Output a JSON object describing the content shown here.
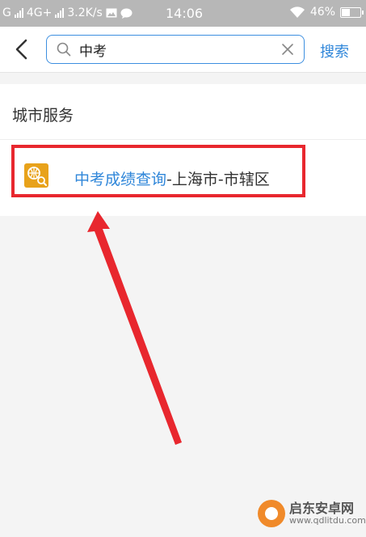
{
  "status_bar": {
    "sim1": "G",
    "sim2": "4G+",
    "speed": "3.2K/s",
    "time": "14:06",
    "battery": "46%",
    "battery_level": 0.46
  },
  "header": {
    "search_value": "中考",
    "search_button": "搜索"
  },
  "section": {
    "title": "城市服务",
    "result": {
      "highlight": "中考成绩查询",
      "rest": "-上海市-市辖区"
    }
  },
  "watermark": {
    "title": "启东安卓网",
    "url": "www.qdlitdu.com"
  },
  "colors": {
    "accent": "#2f86d9",
    "annotation": "#e8272e",
    "icon_bg": "#e8a21a",
    "statusbar": "#b7b7b7"
  },
  "icons": [
    "back-arrow-icon",
    "search-icon",
    "clear-icon",
    "service-search-icon",
    "wifi-icon",
    "battery-icon",
    "signal-icon"
  ]
}
